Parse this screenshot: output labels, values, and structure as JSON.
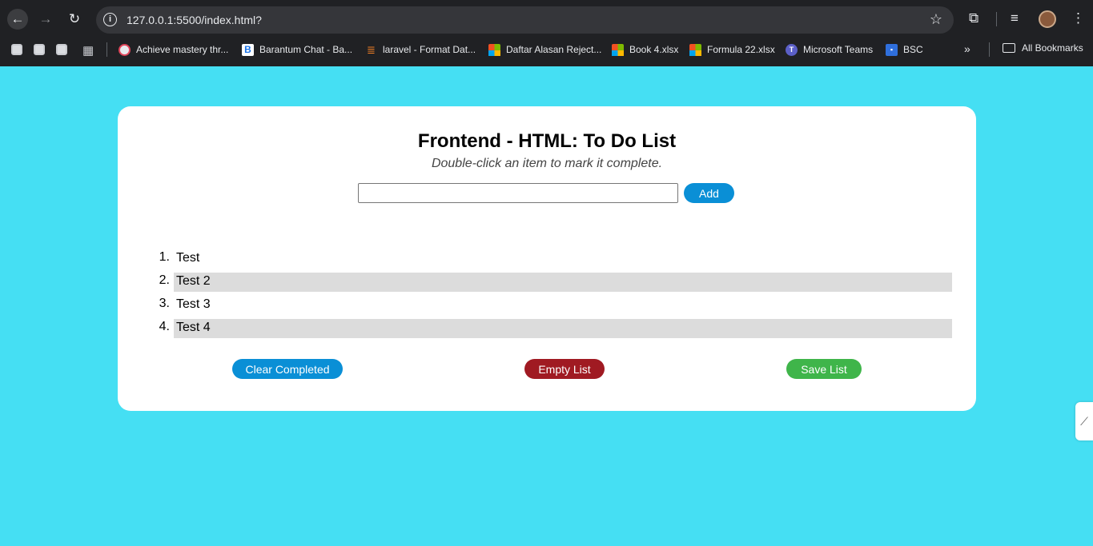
{
  "browser": {
    "url": "127.0.0.1:5500/index.html?",
    "bookmarks": [
      "Achieve mastery thr...",
      "Barantum Chat - Ba...",
      "laravel - Format Dat...",
      "Daftar Alasan Reject...",
      "Book 4.xlsx",
      "Formula 22.xlsx",
      "Microsoft Teams",
      "BSC"
    ],
    "all_bookmarks": "All Bookmarks",
    "more_chevrons": "»"
  },
  "page": {
    "title": "Frontend - HTML: To Do List",
    "subtitle": "Double-click an item to mark it complete.",
    "input_value": "",
    "add_label": "Add",
    "items": [
      {
        "number": "1.",
        "text": "Test",
        "shaded": false
      },
      {
        "number": "2.",
        "text": "Test 2",
        "shaded": true
      },
      {
        "number": "3.",
        "text": "Test 3",
        "shaded": false
      },
      {
        "number": "4.",
        "text": "Test 4",
        "shaded": true
      }
    ],
    "clear_label": "Clear Completed",
    "empty_label": "Empty List",
    "save_label": "Save List"
  },
  "colors": {
    "page_background": "#45dff3",
    "card_background": "#ffffff",
    "primary_button": "#0a8fd6",
    "danger_button": "#a01a22",
    "success_button": "#3fb54a",
    "shaded_row": "#dcdcdc"
  }
}
